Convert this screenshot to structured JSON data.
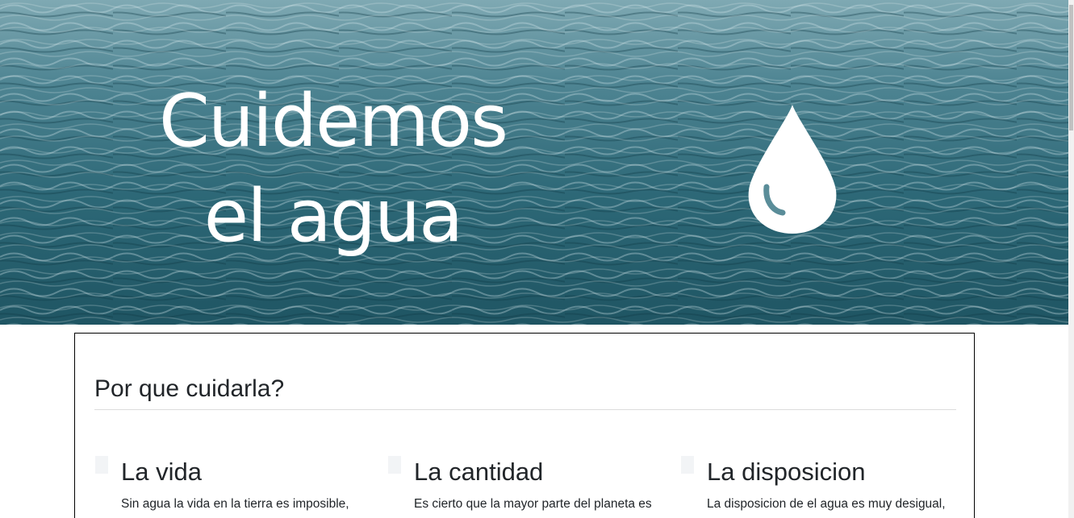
{
  "hero": {
    "title": "Cuidemos el agua",
    "icon": "water-drop-icon"
  },
  "section": {
    "title": "Por que cuidarla?"
  },
  "features": [
    {
      "title": "La vida",
      "text": "Sin agua la vida en la tierra es imposible,"
    },
    {
      "title": "La cantidad",
      "text": "Es cierto que la mayor parte del planeta es"
    },
    {
      "title": "La disposicion",
      "text": "La disposicion de el agua es muy desigual,"
    }
  ],
  "colors": {
    "water_dark": "#1f5563",
    "water_light": "#9cc3cc",
    "text": "#212529",
    "card_border": "#000000"
  }
}
